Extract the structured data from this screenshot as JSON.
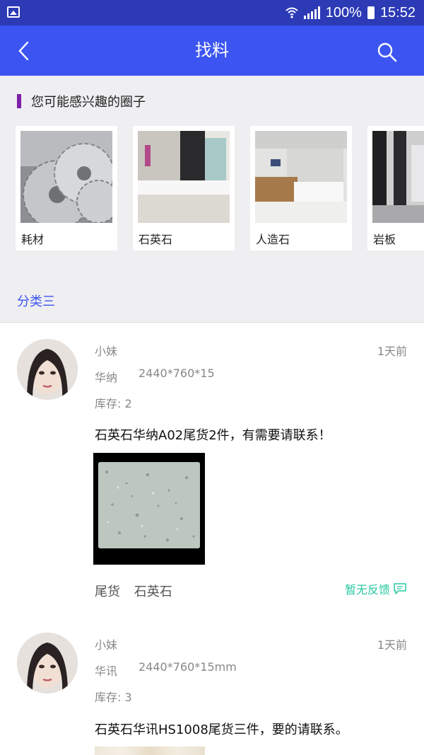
{
  "status_bar": {
    "battery": "100%",
    "time": "15:52"
  },
  "header": {
    "title": "找料"
  },
  "interest_section": {
    "title": "您可能感兴趣的圈子",
    "cards": [
      {
        "label": "耗材"
      },
      {
        "label": "石英石"
      },
      {
        "label": "人造石"
      },
      {
        "label": "岩板"
      }
    ]
  },
  "category": {
    "label": "分类三"
  },
  "posts": [
    {
      "user": "小妹",
      "time": "1天前",
      "brand": "华纳",
      "size": "2440*760*15",
      "stock": "库存: 2",
      "content": "石英石华纳A02尾货2件，有需要请联系！",
      "tags": [
        "尾货",
        "石英石"
      ],
      "feedback": "暂无反馈"
    },
    {
      "user": "小妹",
      "time": "1天前",
      "brand": "华讯",
      "size": "2440*760*15mm",
      "stock": "库存: 3",
      "content": "石英石华讯HS1008尾货三件，要的请联系。"
    }
  ],
  "colors": {
    "status_bar": "#2c3ab5",
    "app_bar": "#3c55f2",
    "accent_purple": "#7d1fa8",
    "category_blue": "#3c55f2",
    "feedback_green": "#27c9a0"
  },
  "icons": {
    "back": "chevron-left-icon",
    "search": "search-icon",
    "feedback": "chat-bubble-icon",
    "gallery": "image-icon"
  }
}
